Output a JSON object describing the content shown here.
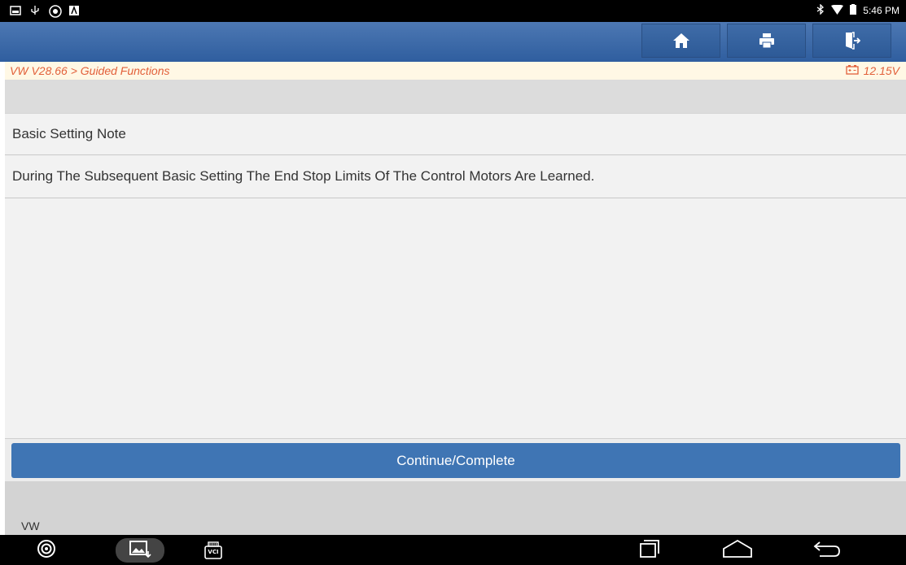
{
  "status_bar": {
    "time": "5:46 PM",
    "left_icons": [
      "notification-icon",
      "usb-icon",
      "bug-icon",
      "app-icon"
    ],
    "right_icons": [
      "bluetooth-icon",
      "wifi-icon",
      "battery-icon"
    ]
  },
  "toolbar": {
    "buttons": [
      "home-icon",
      "print-icon",
      "exit-icon"
    ]
  },
  "breadcrumb": {
    "path": "VW V28.66 > Guided Functions",
    "voltage": "12.15V"
  },
  "content": {
    "title": "Basic Setting Note",
    "message": "During The Subsequent Basic Setting The End Stop Limits Of The Control Motors Are Learned."
  },
  "actions": {
    "continue_label": "Continue/Complete"
  },
  "footer": {
    "label": "VW"
  },
  "nav_bar": {
    "items": [
      "browser-icon",
      "gallery-icon",
      "vci-icon",
      "recents-icon",
      "home-nav-icon",
      "back-icon"
    ],
    "vci_label": "VCI"
  },
  "colors": {
    "accent_blue": "#3f75b4",
    "breadcrumb_text": "#e2603a",
    "breadcrumb_bg": "#fff8e5"
  }
}
